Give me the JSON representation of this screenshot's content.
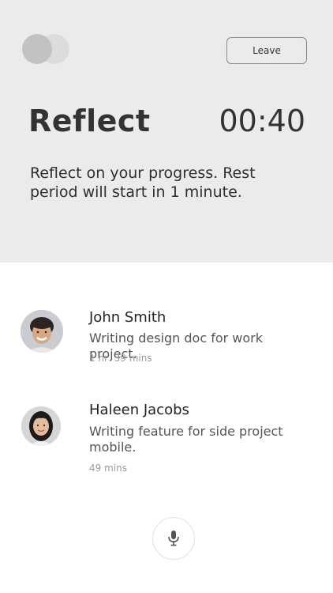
{
  "header": {
    "leave_label": "Leave",
    "title": "Reflect",
    "timer": "00:40",
    "description": "Reflect on your progress. Rest period will start in 1 minute."
  },
  "participants": [
    {
      "name": "John Smith",
      "task": "Writing design doc for work project.",
      "duration": "1 hr  39 mins"
    },
    {
      "name": "Haleen Jacobs",
      "task": "Writing feature for side project mobile.",
      "duration": "49 mins"
    }
  ],
  "icons": {
    "logo": "logo-icon",
    "mic": "microphone-icon"
  },
  "colors": {
    "header_bg": "#ebebeb",
    "text_primary": "#333333",
    "text_secondary": "#555555",
    "text_muted": "#9a9a9a"
  }
}
